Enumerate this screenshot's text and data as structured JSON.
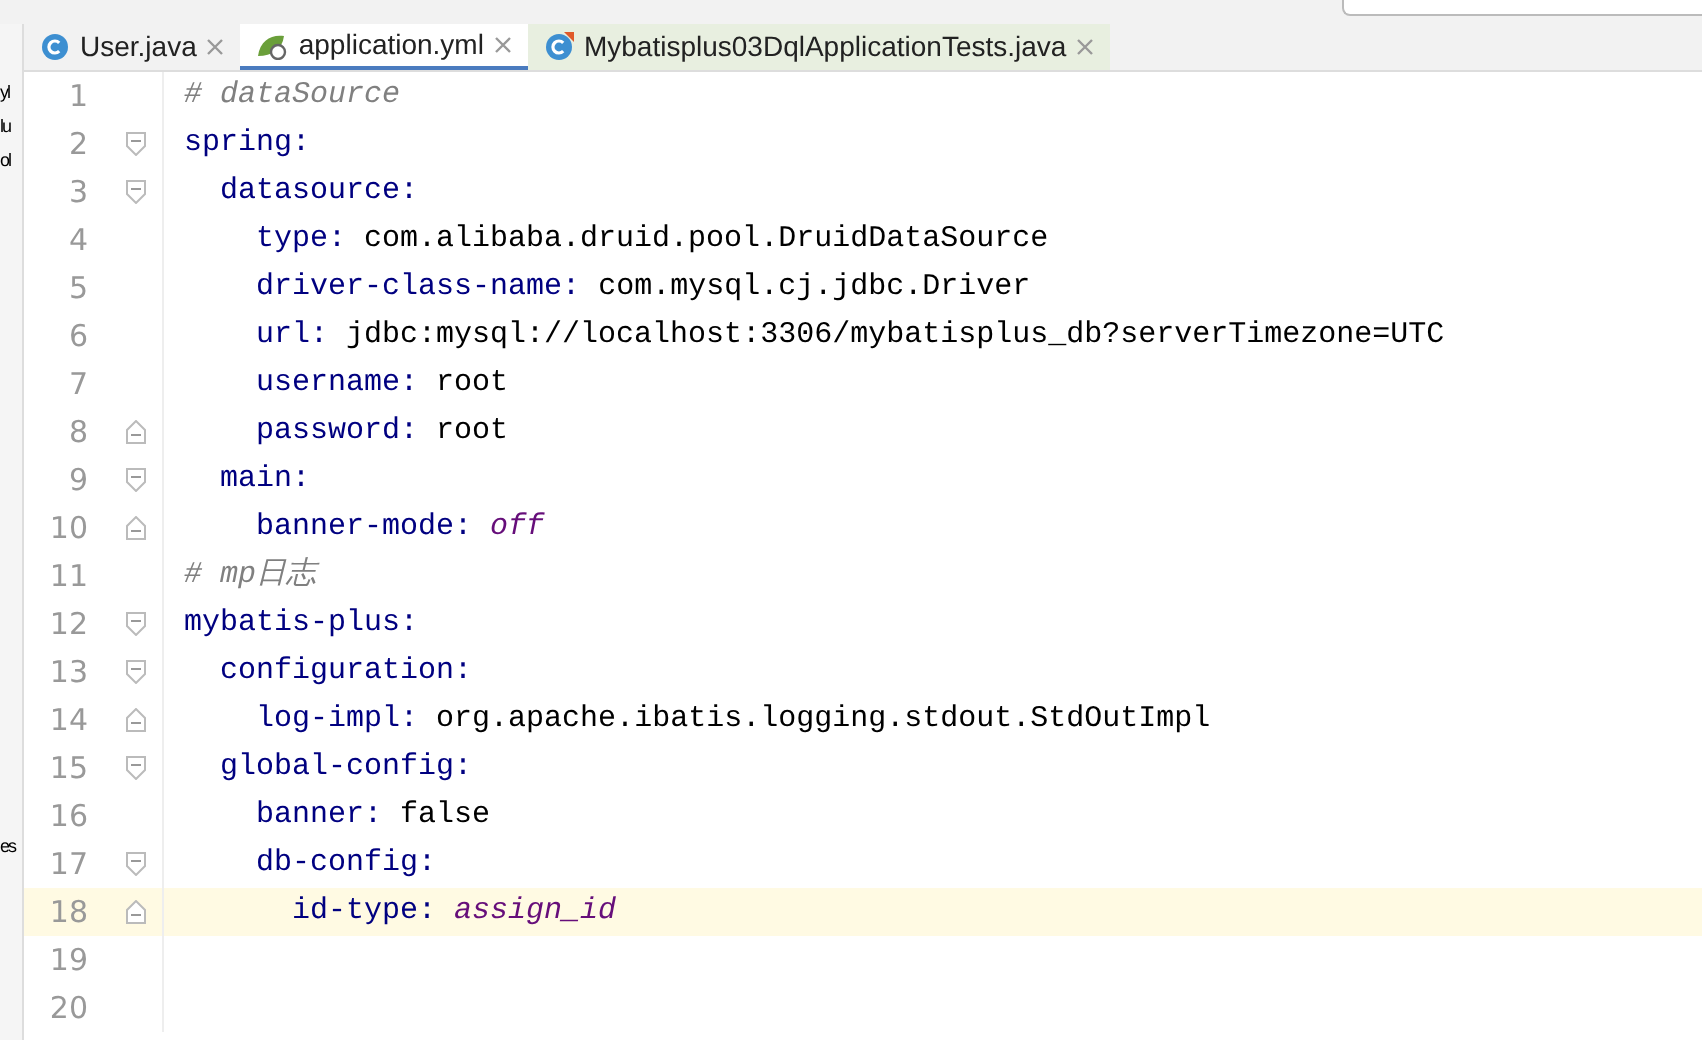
{
  "project_fragments": [
    "yl",
    "lu",
    "ol",
    "es"
  ],
  "tabs": [
    {
      "label": "User.java",
      "kind": "class",
      "selected": false
    },
    {
      "label": "application.yml",
      "kind": "spring",
      "selected": true
    },
    {
      "label": "Mybatisplus03DqlApplicationTests.java",
      "kind": "test",
      "selected": false
    }
  ],
  "lines": [
    {
      "number": "1",
      "kind": "comment",
      "text": "# dataSource",
      "selected": false
    },
    {
      "number": "2",
      "kind": "pair",
      "key": "spring:",
      "fold_start": true,
      "fold_end": false,
      "selected": false
    },
    {
      "number": "3",
      "kind": "pair",
      "key": "  datasource:",
      "fold_start": true,
      "fold_end": false,
      "selected": false
    },
    {
      "number": "4",
      "kind": "pair",
      "key": "    type:",
      "value": "com.alibaba.druid.pool.DruidDataSource",
      "constant": false,
      "fold_start": false,
      "fold_end": false,
      "selected": false
    },
    {
      "number": "5",
      "kind": "pair",
      "key": "    driver-class-name:",
      "value": "com.mysql.cj.jdbc.Driver",
      "constant": false,
      "fold_start": false,
      "fold_end": false,
      "selected": false
    },
    {
      "number": "6",
      "kind": "pair",
      "key": "    url:",
      "value": "jdbc:mysql://localhost:3306/mybatisplus_db?serverTimezone=UTC",
      "constant": false,
      "fold_start": false,
      "fold_end": false,
      "selected": false
    },
    {
      "number": "7",
      "kind": "pair",
      "key": "    username:",
      "value": "root",
      "constant": false,
      "fold_start": false,
      "fold_end": false,
      "selected": false
    },
    {
      "number": "8",
      "kind": "pair",
      "key": "    password:",
      "value": "root",
      "constant": false,
      "fold_start": false,
      "fold_end": true,
      "selected": false
    },
    {
      "number": "9",
      "kind": "pair",
      "key": "  main:",
      "fold_start": true,
      "fold_end": false,
      "selected": false
    },
    {
      "number": "10",
      "kind": "pair",
      "key": "    banner-mode:",
      "value": "off",
      "constant": true,
      "fold_start": false,
      "fold_end": true,
      "selected": false
    },
    {
      "number": "11",
      "kind": "comment",
      "text": "# mp日志",
      "selected": false
    },
    {
      "number": "12",
      "kind": "pair",
      "key": "mybatis-plus:",
      "fold_start": true,
      "fold_end": false,
      "selected": false
    },
    {
      "number": "13",
      "kind": "pair",
      "key": "  configuration:",
      "fold_start": true,
      "fold_end": false,
      "selected": false
    },
    {
      "number": "14",
      "kind": "pair",
      "key": "    log-impl:",
      "value": "org.apache.ibatis.logging.stdout.StdOutImpl",
      "constant": false,
      "fold_start": false,
      "fold_end": true,
      "selected": false
    },
    {
      "number": "15",
      "kind": "pair",
      "key": "  global-config:",
      "fold_start": true,
      "fold_end": false,
      "selected": false
    },
    {
      "number": "16",
      "kind": "pair",
      "key": "    banner:",
      "value": "false",
      "constant": false,
      "fold_start": false,
      "fold_end": false,
      "selected": false
    },
    {
      "number": "17",
      "kind": "pair",
      "key": "    db-config:",
      "fold_start": true,
      "fold_end": false,
      "selected": false
    },
    {
      "number": "18",
      "kind": "pair",
      "key": "      id-type:",
      "value": "assign_id",
      "constant": true,
      "fold_start": false,
      "fold_end": true,
      "selected": true
    },
    {
      "number": "19",
      "kind": "blank",
      "selected": false
    },
    {
      "number": "20",
      "kind": "blank",
      "selected": false
    }
  ]
}
